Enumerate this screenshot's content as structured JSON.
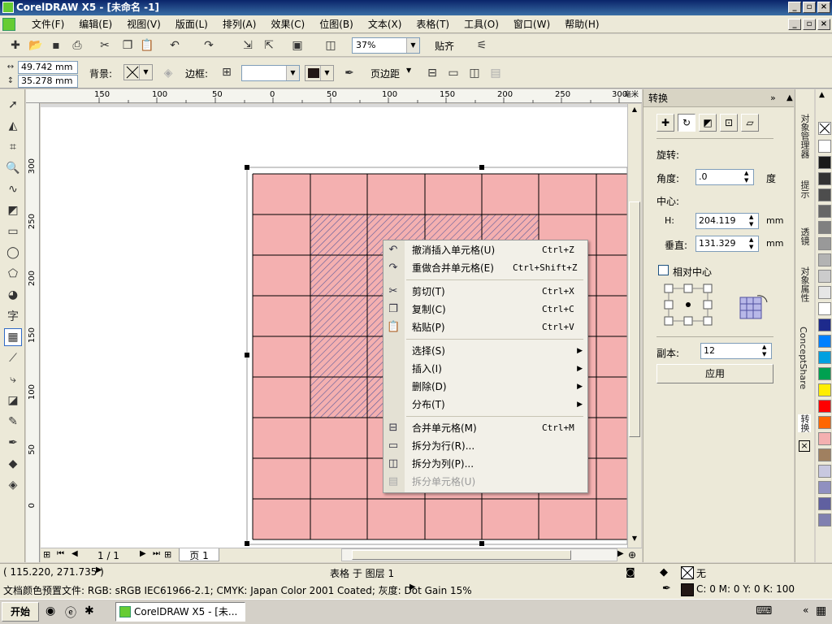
{
  "window": {
    "title": "CorelDRAW X5 - [未命名 -1]"
  },
  "menu": [
    "文件(F)",
    "编辑(E)",
    "视图(V)",
    "版面(L)",
    "排列(A)",
    "效果(C)",
    "位图(B)",
    "文本(X)",
    "表格(T)",
    "工具(O)",
    "窗口(W)",
    "帮助(H)"
  ],
  "toolbar1": {
    "zoom": "37%",
    "snap_label": "贴齐"
  },
  "toolbar2": {
    "width": "49.742 mm",
    "height": "35.278 mm",
    "bg_label": "背景:",
    "border_label": "边框:",
    "margin_label": "页边距"
  },
  "ruler": {
    "h_ticks": [
      "150",
      "100",
      "50",
      "0",
      "50",
      "100",
      "150",
      "200",
      "250",
      "300"
    ],
    "h_unit": "毫米",
    "v_ticks": [
      "300",
      "250",
      "200",
      "150",
      "100",
      "50",
      "0"
    ]
  },
  "context_menu": {
    "items": [
      {
        "label": "撤消插入单元格(U)",
        "shortcut": "Ctrl+Z",
        "icon": "undo-icon"
      },
      {
        "label": "重做合并单元格(E)",
        "shortcut": "Ctrl+Shift+Z",
        "icon": "redo-icon"
      },
      {
        "label": "剪切(T)",
        "shortcut": "Ctrl+X",
        "icon": "scissors-icon"
      },
      {
        "label": "复制(C)",
        "shortcut": "Ctrl+C",
        "icon": "copy-icon"
      },
      {
        "label": "粘贴(P)",
        "shortcut": "Ctrl+V",
        "icon": "paste-icon"
      },
      {
        "label": "选择(S)",
        "submenu": true
      },
      {
        "label": "插入(I)",
        "submenu": true
      },
      {
        "label": "删除(D)",
        "submenu": true
      },
      {
        "label": "分布(T)",
        "submenu": true
      },
      {
        "label": "合并单元格(M)",
        "shortcut": "Ctrl+M",
        "icon": "merge-icon"
      },
      {
        "label": "拆分为行(R)...",
        "icon": "split-rows-icon"
      },
      {
        "label": "拆分为列(P)...",
        "icon": "split-cols-icon"
      },
      {
        "label": "拆分单元格(U)",
        "icon": "split-cell-icon",
        "disabled": true
      }
    ]
  },
  "docker": {
    "title": "转换",
    "rotate_label": "旋转:",
    "angle_label": "角度:",
    "angle_value": ".0",
    "angle_unit": "度",
    "center_label": "中心:",
    "h_label": "H:",
    "h_value": "204.119",
    "v_label": "垂直:",
    "v_value": "131.329",
    "unit": "mm",
    "relative_center": "相对中心",
    "copies_label": "副本:",
    "copies_value": "12",
    "apply": "应用"
  },
  "docker_tabs": [
    "对象管理器",
    "提示",
    "透镜",
    "对象属性",
    "ConceptShare",
    "转换"
  ],
  "page_nav": {
    "current": "1 / 1",
    "page_tab": "页 1"
  },
  "status": {
    "coords": "( 115.220, 271.735 )",
    "object_info": "表格 于 图层 1",
    "fill_label": "无",
    "profile": "文档颜色预置文件: RGB: sRGB IEC61966-2.1; CMYK: Japan Color 2001 Coated; 灰度: Dot Gain 15%",
    "outline_color": "C: 0 M: 0 Y: 0 K: 100"
  },
  "taskbar": {
    "start": "开始",
    "task": "CorelDRAW X5 - [未..."
  },
  "colors": {
    "table_fill": "#f4b0b0",
    "hatch": "#5a5a9a",
    "palette": [
      "#ffffff",
      "#1a1a1a",
      "#333333",
      "#4d4d4d",
      "#666666",
      "#808080",
      "#999999",
      "#b3b3b3",
      "#cccccc",
      "#e6e6e6",
      "#ffffff",
      "#1d2a8c",
      "#0080ff",
      "#00a0e0",
      "#00a050",
      "#ffee00",
      "#ff0000",
      "#ff6600",
      "#f4b0b0",
      "#a08060",
      "#c8c8e0",
      "#9090c0",
      "#6060a0",
      "#8080b0"
    ]
  }
}
